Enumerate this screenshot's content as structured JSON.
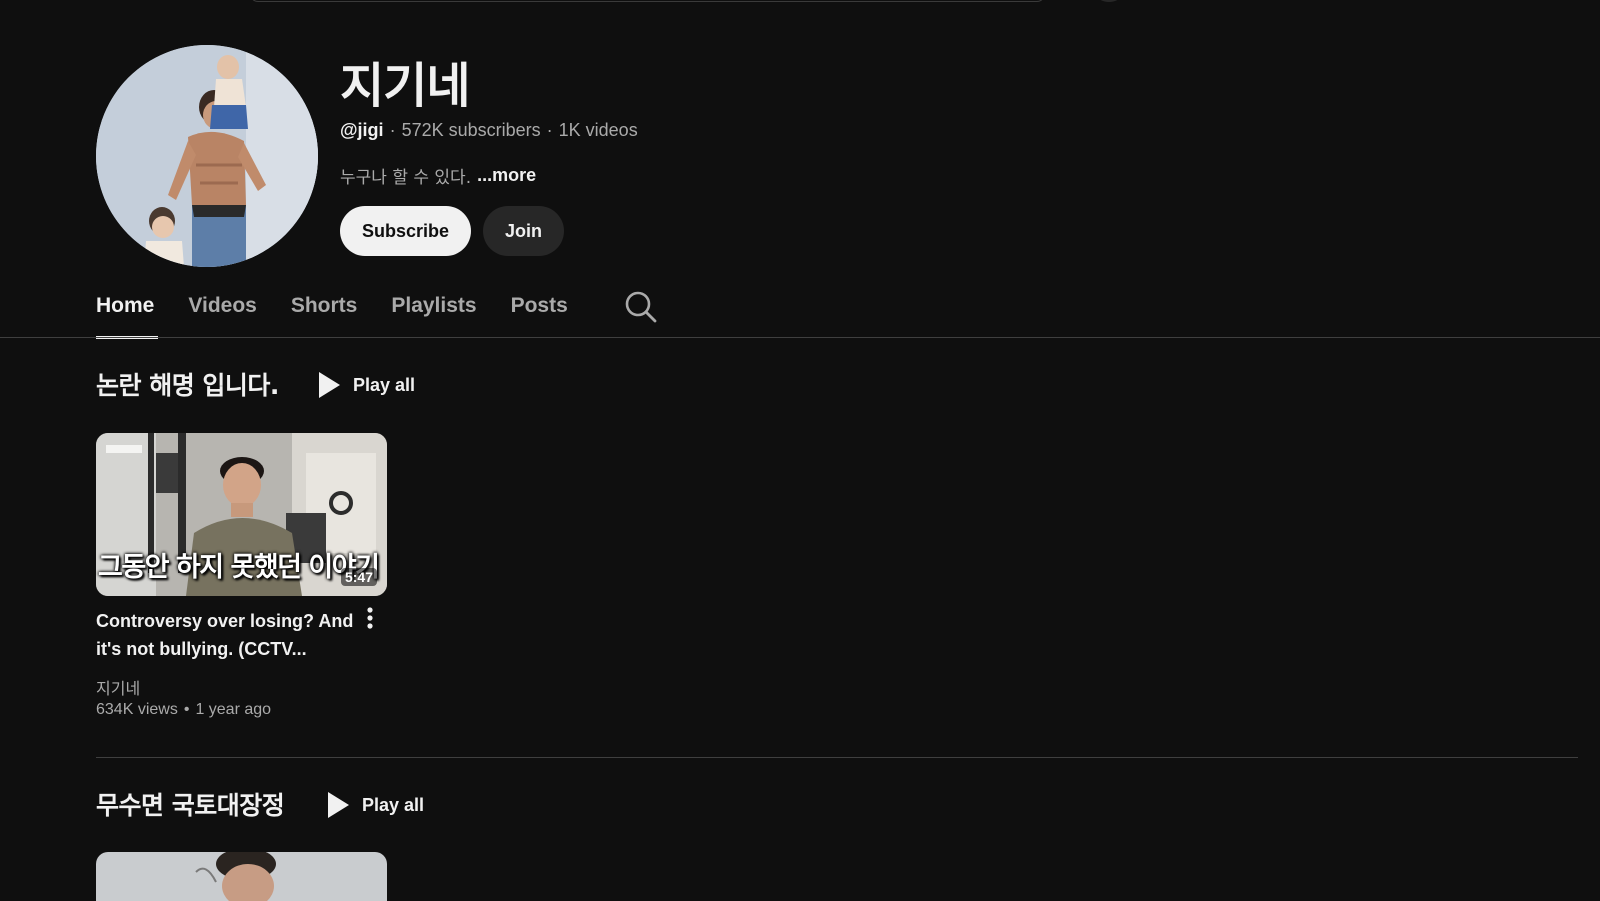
{
  "channel": {
    "name": "지기네",
    "handle": "@jigi",
    "subscribers": "572K subscribers",
    "videos_count": "1K videos",
    "separator": "·",
    "description": "누구나 할 수 있다.",
    "more_label": "...more",
    "subscribe_label": "Subscribe",
    "join_label": "Join"
  },
  "tabs": [
    {
      "label": "Home",
      "active": true
    },
    {
      "label": "Videos",
      "active": false
    },
    {
      "label": "Shorts",
      "active": false
    },
    {
      "label": "Playlists",
      "active": false
    },
    {
      "label": "Posts",
      "active": false
    }
  ],
  "shelves": [
    {
      "title": "논란 해명 입니다.",
      "play_all_label": "Play all",
      "videos": [
        {
          "thumbnail_caption": "그동안 하지 못했던 이야기",
          "duration": "5:47",
          "title": "Controversy over losing? And it's not bullying. (CCTV...",
          "channel": "지기네",
          "views": "634K views",
          "stats_separator": "•",
          "age": "1 year ago"
        }
      ]
    },
    {
      "title": "무수면 국토대장정",
      "play_all_label": "Play all"
    }
  ],
  "icons": {
    "search": "search-icon",
    "play": "play-icon",
    "more": "more-vert-icon"
  },
  "colors": {
    "background": "#0f0f0f",
    "text_primary": "#f1f1f1",
    "text_secondary": "#aaaaaa",
    "subscribe_bg": "#f1f1f1",
    "join_bg": "#272727"
  }
}
